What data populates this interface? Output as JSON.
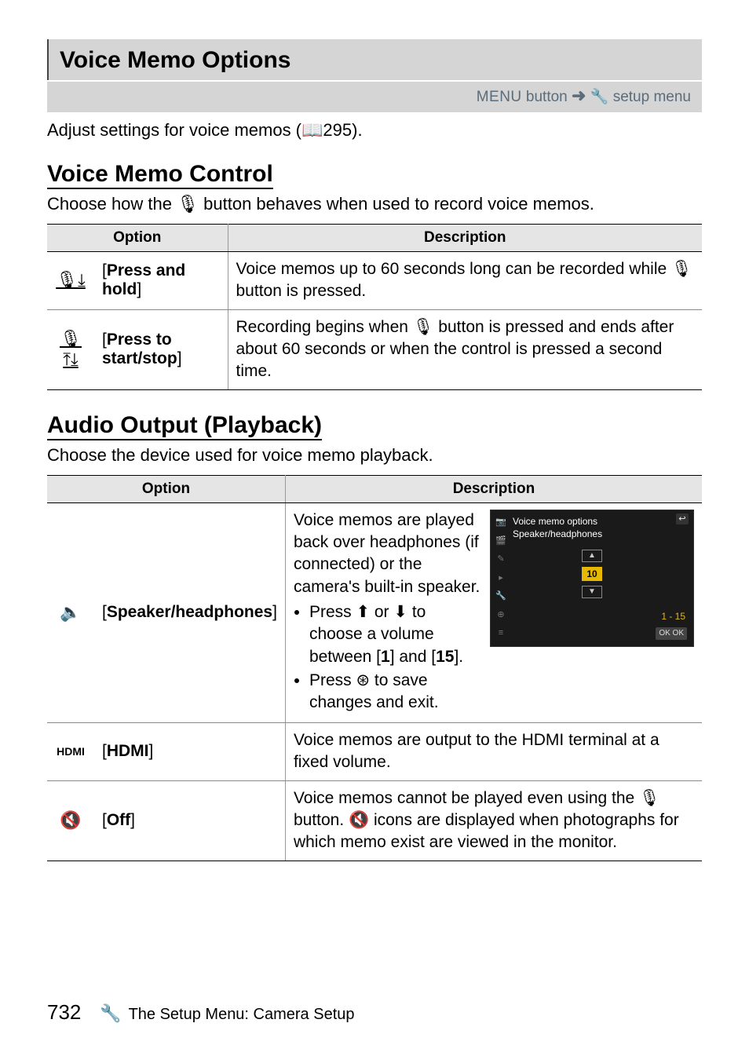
{
  "section": {
    "title": "Voice Memo Options",
    "menu_button": "MENU",
    "menu_label": " button ",
    "arrow": "➜",
    "setup_icon": "🔧",
    "setup_label": " setup menu"
  },
  "intro": {
    "text_before": "Adjust settings for voice memos (",
    "book": "📖",
    "page_ref": "295).",
    "full": "Adjust settings for voice memos (📖295)."
  },
  "voice_control": {
    "heading": "Voice Memo Control",
    "subtext": "Choose how the 🎙 button behaves when used to record voice memos.",
    "cols": {
      "option": "Option",
      "description": "Description"
    },
    "rows": [
      {
        "icon": "🎙⤓",
        "label": "[Press and hold]",
        "label_bold": "Press and hold",
        "desc": "Voice memos up to 60 seconds long can be recorded while 🎙 button is pressed."
      },
      {
        "icon": "🎙⤒⤓",
        "label": "[Press to start/stop]",
        "label_bold": "Press to start/stop",
        "desc": "Recording begins when 🎙 button is pressed and ends after about 60 seconds or when the control is pressed a second time."
      }
    ]
  },
  "audio_output": {
    "heading": "Audio Output (Playback)",
    "subtext": "Choose the device used for voice memo playback.",
    "cols": {
      "option": "Option",
      "description": "Description"
    },
    "rows": [
      {
        "icon": "🔈",
        "label_bold": "Speaker/headphones",
        "desc_lines": [
          "Voice memos are played back over headphones (if connected) or the camera's built-in speaker."
        ],
        "bullets": [
          "Press ⬆ or ⬇ to choose a volume between [1] and [15].",
          "Press ⊛ to save changes and exit."
        ],
        "bullet1_prefix": "Press ⬆ or ⬇ to choose a volume between [",
        "bullet1_b1": "1",
        "bullet1_mid": "] and [",
        "bullet1_b2": "15",
        "bullet1_suffix": "].",
        "bullet2": "Press ⊛ to save changes and exit.",
        "screenshot": {
          "title": "Voice memo options",
          "subtitle": "Speaker/headphones",
          "value": "10",
          "range": "1 - 15",
          "ok": "OK OK",
          "return": "↩"
        }
      },
      {
        "icon": "HDMI",
        "label_bold": "HDMI",
        "desc": "Voice memos are output to the HDMI terminal at a fixed volume."
      },
      {
        "icon": "🔇",
        "label_bold": "Off",
        "desc": "Voice memos cannot be played even using the 🎙 button. 🔇 icons are displayed when photographs for which memo exist are viewed in the monitor."
      }
    ]
  },
  "footer": {
    "page": "732",
    "wrench": "🔧",
    "text": "The Setup Menu: Camera Setup"
  }
}
